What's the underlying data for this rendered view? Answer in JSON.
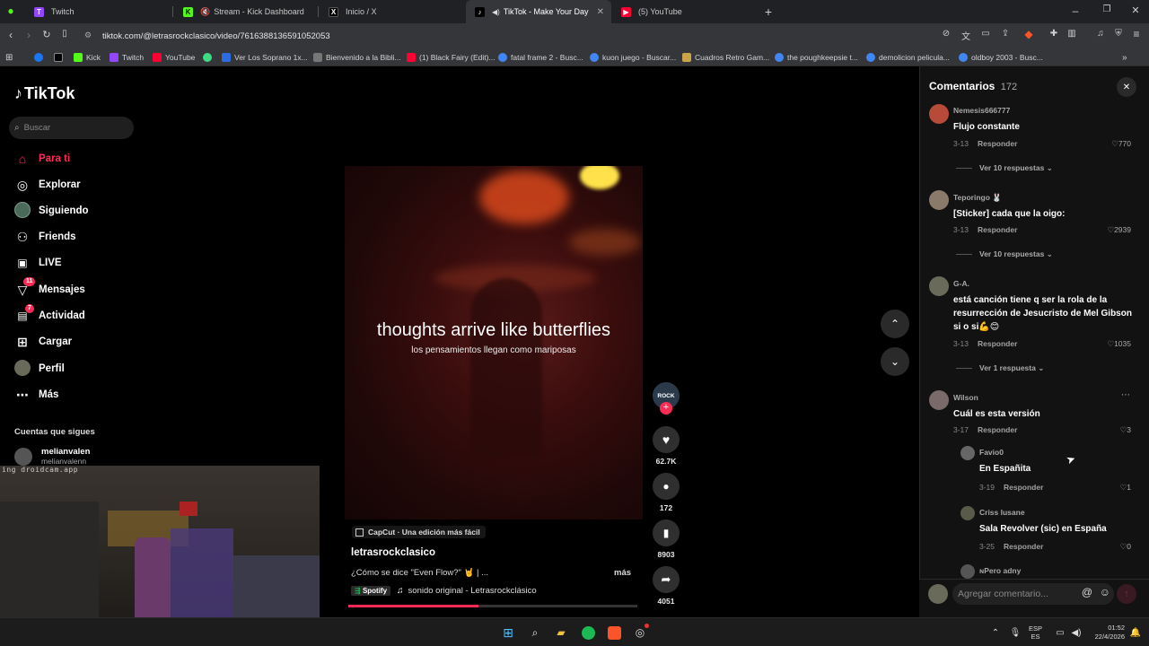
{
  "browser": {
    "tabs": [
      {
        "label": "Twitch",
        "icon_color": "#9146ff",
        "icon_glyph": "T"
      },
      {
        "label": "Stream - Kick Dashboard",
        "icon_color": "#53fc18",
        "icon_glyph": "K"
      },
      {
        "label": "Inicio / X",
        "icon_color": "#000000",
        "icon_glyph": "X"
      },
      {
        "label": "TikTok - Make Your Day",
        "icon_color": "#000000",
        "icon_glyph": "♪"
      },
      {
        "label": "(5) YouTube",
        "icon_color": "#ff0033",
        "icon_glyph": "▶"
      }
    ],
    "active_tab": 3,
    "url": "tiktok.com/@letrasrockclasico/video/7616388136591052053",
    "bookmarks": [
      {
        "label": "",
        "color": "#1877f2"
      },
      {
        "label": "",
        "color": "#000000"
      },
      {
        "label": "Kick",
        "color": "#53fc18"
      },
      {
        "label": "Twitch",
        "color": "#9146ff"
      },
      {
        "label": "YouTube",
        "color": "#ff0033"
      },
      {
        "label": "",
        "color": "#3ddc84"
      },
      {
        "label": "Ver Los Soprano 1x...",
        "color": "#2d6cdf"
      },
      {
        "label": "Bienvenido a la Bibli...",
        "color": "#777777"
      },
      {
        "label": "(1) Black Fairy (Edit)...",
        "color": "#ff0033"
      },
      {
        "label": "fatal frame 2 - Busc...",
        "color": "#4285f4"
      },
      {
        "label": "kuon juego - Buscar...",
        "color": "#4285f4"
      },
      {
        "label": "Cuadros Retro Gam...",
        "color": "#c8a34a"
      },
      {
        "label": "the poughkeepsie t...",
        "color": "#4285f4"
      },
      {
        "label": "demolicion pelicula...",
        "color": "#4285f4"
      },
      {
        "label": "oldboy 2003 - Busc...",
        "color": "#4285f4"
      }
    ]
  },
  "tiktok": {
    "logo": "TikTok",
    "search_placeholder": "Buscar",
    "nav": [
      {
        "label": "Para ti",
        "icon": "home-icon",
        "glyph": "⌂",
        "active": true
      },
      {
        "label": "Explorar",
        "icon": "compass-icon",
        "glyph": "◎"
      },
      {
        "label": "Siguiendo",
        "icon": "following-avatar-icon",
        "glyph": "●"
      },
      {
        "label": "Friends",
        "icon": "friends-icon",
        "glyph": "⚇"
      },
      {
        "label": "LIVE",
        "icon": "live-icon",
        "glyph": "▣"
      },
      {
        "label": "Mensajes",
        "icon": "messages-icon",
        "glyph": "▽",
        "badge": "11"
      },
      {
        "label": "Actividad",
        "icon": "activity-icon",
        "glyph": "▤",
        "badge": "7"
      },
      {
        "label": "Cargar",
        "icon": "upload-icon",
        "glyph": "⊞"
      },
      {
        "label": "Perfil",
        "icon": "profile-avatar-icon",
        "glyph": "●"
      },
      {
        "label": "Más",
        "icon": "more-icon",
        "glyph": "⋯"
      }
    ],
    "following_title": "Cuentas que sigues",
    "following": [
      {
        "name": "melianvalen",
        "handle": "melianvalenn"
      }
    ],
    "video": {
      "caption_en": "thoughts arrive like butterflies",
      "caption_es": "los pensamientos llegan como mariposas",
      "capcut_label": "CapCut · Una edición más fácil",
      "author": "letrasrockclasico",
      "description": "¿Cómo se dice \"Even Flow?\" 🤘 | ...",
      "more_label": "más",
      "spotify_label": "Spotify",
      "sound": "sonido original - Letrasrockclásico",
      "progress": 0.45
    },
    "actions": {
      "avatar_text": "ROCK",
      "likes": "62.7K",
      "comments": "172",
      "saves": "8903",
      "shares": "4051"
    }
  },
  "comments_panel": {
    "title": "Comentarios",
    "count": "172",
    "reply_label": "Responder",
    "input_placeholder": "Agregar comentario...",
    "comments": [
      {
        "user": "Nemesis666777",
        "text": "Flujo constante",
        "date": "3-13",
        "likes": "770",
        "replies_label": "Ver 10 respuestas",
        "avatar_color": "#b84a3a"
      },
      {
        "user": "Teporingo 🐰",
        "text": "[Sticker] cada que la oigo:",
        "date": "3-13",
        "likes": "2939",
        "replies_label": "Ver 10 respuestas",
        "avatar_color": "#8a7a6a"
      },
      {
        "user": "G-A.",
        "text": "está canción tiene q ser la rola de la resurrección de Jesucristo de Mel Gibson si o si💪😊",
        "date": "3-13",
        "likes": "1035",
        "replies_label": "Ver 1 respuesta",
        "avatar_color": "#6a6a5a"
      },
      {
        "user": "Wilson",
        "text": "Cuál es esta versión",
        "date": "3-17",
        "likes": "3",
        "avatar_color": "#7a6a6a"
      }
    ],
    "replies": [
      {
        "user": "Favio0",
        "text": "En Españita",
        "date": "3-19",
        "likes": "1",
        "avatar_color": "#666666"
      },
      {
        "user": "Criss lusane",
        "text": "Sala Revolver (sic) en España",
        "date": "3-25",
        "likes": "0",
        "avatar_color": "#5a5a4a"
      }
    ],
    "partial_user": "ɴPero adny"
  },
  "webcam": {
    "watermark": "ing droidcam.app"
  },
  "taskbar": {
    "lang_top": "ESP",
    "lang_bottom": "ES",
    "time": "01:52",
    "date": "22/4/2026"
  }
}
